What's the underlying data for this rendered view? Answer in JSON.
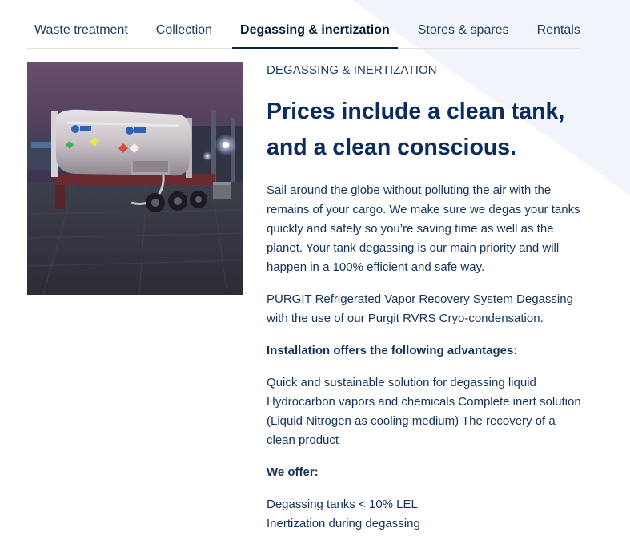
{
  "tabs": [
    {
      "label": "Waste treatment",
      "active": false
    },
    {
      "label": "Collection",
      "active": false
    },
    {
      "label": "Degassing & inertization",
      "active": true
    },
    {
      "label": "Stores & spares",
      "active": false
    },
    {
      "label": "Rentals",
      "active": false
    }
  ],
  "section": {
    "eyebrow": "DEGASSING & INERTIZATION",
    "headline_line1": "Prices include a clean tank,",
    "headline_line2": "and a clean conscious.",
    "intro": "Sail around the globe without polluting the air with the remains of your cargo. We make sure we degas your tanks quickly and safely so you’re saving time as well as the planet. Your tank degassing is our main priority and will happen in a 100% efficient and safe way.",
    "system": "PURGIT Refrigerated Vapor Recovery System Degassing with the use of our Purgit RVRS Cryo-condensation.",
    "advantages_heading": "Installation offers the following advantages:",
    "advantages": "Quick and sustainable solution for degassing liquid Hydrocarbon vapors and chemicals Complete inert solution (Liquid Nitrogen as cooling medium) The recovery of a clean product",
    "offer_heading": "We offer:",
    "offers": [
      "Degassing tanks < 10% LEL",
      "Inertization during degassing"
    ]
  },
  "colors": {
    "heading": "#0c2c5c",
    "text": "#15335a",
    "swoosh": "#f1f5fb"
  }
}
